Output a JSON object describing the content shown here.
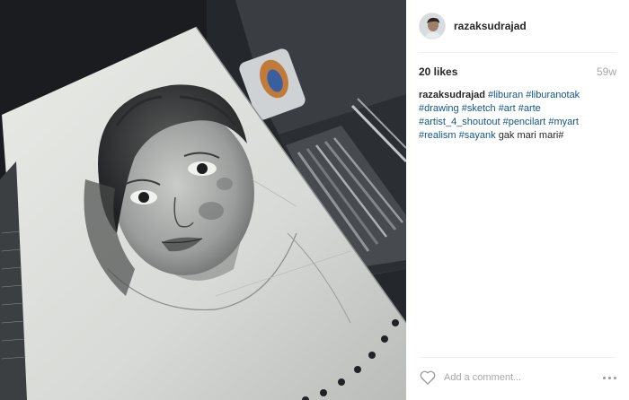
{
  "post": {
    "username": "razaksudrajad",
    "likes": "20 likes",
    "time_ago": "59w",
    "caption": {
      "author": "razaksudrajad",
      "tags": [
        "#liburan",
        "#liburanotak",
        "#drawing",
        "#sketch",
        "#art",
        "#arte",
        "#artist_4_shoutout",
        "#pencilart",
        "#myart",
        "#realism",
        "#sayank"
      ],
      "trailing_text": "gak mari mari#"
    },
    "comment_placeholder": "Add a comment...",
    "icons": {
      "like": "heart-outline-icon",
      "more": "more-options-icon"
    }
  },
  "colors": {
    "hashtag": "#125688",
    "muted": "#a5a7aa",
    "text": "#262626"
  }
}
